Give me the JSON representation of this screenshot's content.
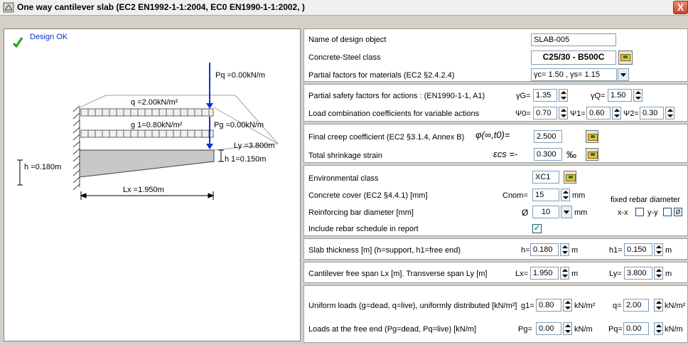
{
  "window": {
    "title": "One way cantilever slab (EC2 EN1992-1-1:2004, EC0 EN1990-1-1:2002, )",
    "close_label": "X"
  },
  "status": {
    "text": "Design OK",
    "color": "#21a121"
  },
  "drawing": {
    "pq": "Pq =0.00kN/m",
    "q": "q =2.00kN/m²",
    "g1": "g 1=0.80kN/m²",
    "pg": "Pg =0.00kN/m",
    "ly": "Ly =3.800m",
    "h": "h =0.180m",
    "h1": "h 1=0.150m",
    "lx": "Lx =1.950m"
  },
  "form": {
    "name_label": "Name of design object",
    "name_value": "SLAB-005",
    "class_label": "Concrete-Steel class",
    "class_value": "C25/30 - B500C",
    "partial_mat_label": "Partial factors for materials (EC2 §2.4.2.4)",
    "partial_mat_value": "γc= 1.50 , γs= 1.15",
    "psf_label": "Partial safety factors for actions : (EN1990-1-1, A1)",
    "gammaG_label": "γG=",
    "gammaG_value": "1.35",
    "gammaQ_label": "γQ=",
    "gammaQ_value": "1.50",
    "lcc_label": "Load combination coefficients for variable actions",
    "psi0_label": "Ψ0=",
    "psi0_value": "0.70",
    "psi1_label": "Ψ1=",
    "psi1_value": "0.60",
    "psi2_label": "Ψ2=",
    "psi2_value": "0.30",
    "creep_label": "Final creep coefficient (EC2 §3.1.4, Annex B)",
    "creep_symbol": "φ(∞,t0)=",
    "creep_value": "2.500",
    "shrink_label": "Total shrinkage strain",
    "shrink_symbol": "εcs =-",
    "shrink_value": "0.300",
    "shrink_unit": "‰",
    "env_label": "Environmental class",
    "env_value": "XC1",
    "cover_label": "Concrete cover (EC2 §4.4.1) [mm]",
    "cover_symbol": "Cnom=",
    "cover_value": "15",
    "cover_unit": "mm",
    "fixed_label": "fixed rebar diameter",
    "xx_label": "x-x",
    "yy_label": "y-y",
    "ydiam_label": "Ø",
    "bar_label": "Reinforcing bar diameter [mm]",
    "bar_symbol": "Ø",
    "bar_value": "10",
    "bar_unit": "mm",
    "schedule_label": "Include rebar schedule in report",
    "schedule_checked": "✓",
    "thick_label": "Slab thickness [m] (h=support, h1=free end)",
    "h_label": "h=",
    "h_value": "0.180",
    "h_unit": "m",
    "h1_label": "h1=",
    "h1_value": "0.150",
    "h1_unit": "m",
    "span_label": "Cantilever free span Lx [m].   Transverse span Ly [m]",
    "lx_label": "Lx=",
    "lx_value": "1.950",
    "lx_unit": "m",
    "ly_label": "Ly=",
    "ly_value": "3.800",
    "ly_unit": "m",
    "uni_label": "Uniform loads (g=dead, q=live), uniformly distributed [kN/m²]",
    "g1_label": "g1=",
    "g1_value": "0.80",
    "g1_unit": "kN/m²",
    "q_label": "q=",
    "q_value": "2.00",
    "q_unit": "kN/m²",
    "end_label": "Loads at the free end (Pg=dead, Pq=live) [kN/m]",
    "pg_label": "Pg=",
    "pg_value": "0.00",
    "pg_unit": "kN/m",
    "pq_label": "Pq=",
    "pq_value": "0.00",
    "pq_unit": "kN/m"
  }
}
